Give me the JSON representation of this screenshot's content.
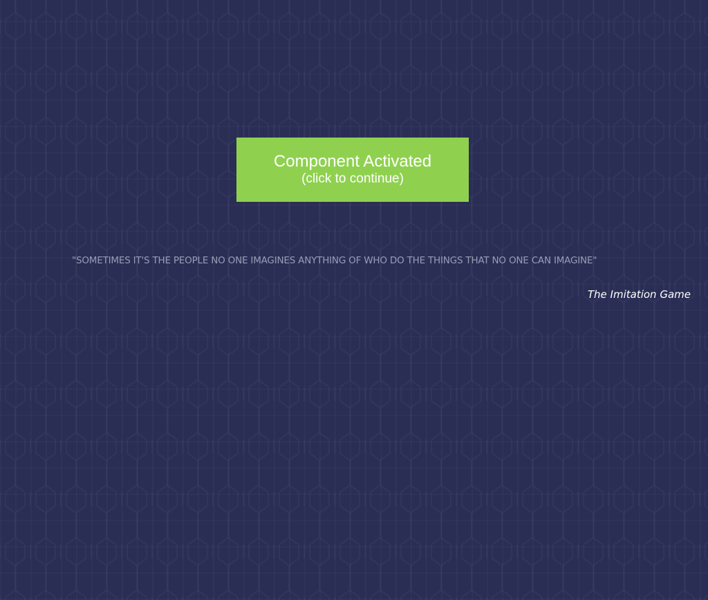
{
  "colors": {
    "background": "#2a2e55",
    "button": "#8fd14f",
    "button_text": "#ffffff",
    "quote_text": "#9a9db3",
    "attribution_text": "#ffffff"
  },
  "button": {
    "title": "Component Activated",
    "subtitle": "(click to continue)"
  },
  "quote": {
    "text": "\"SOMETIMES IT'S THE PEOPLE NO ONE IMAGINES ANYTHING OF WHO DO THE THINGS THAT NO ONE CAN IMAGINE\"",
    "source": "The Imitation Game"
  }
}
